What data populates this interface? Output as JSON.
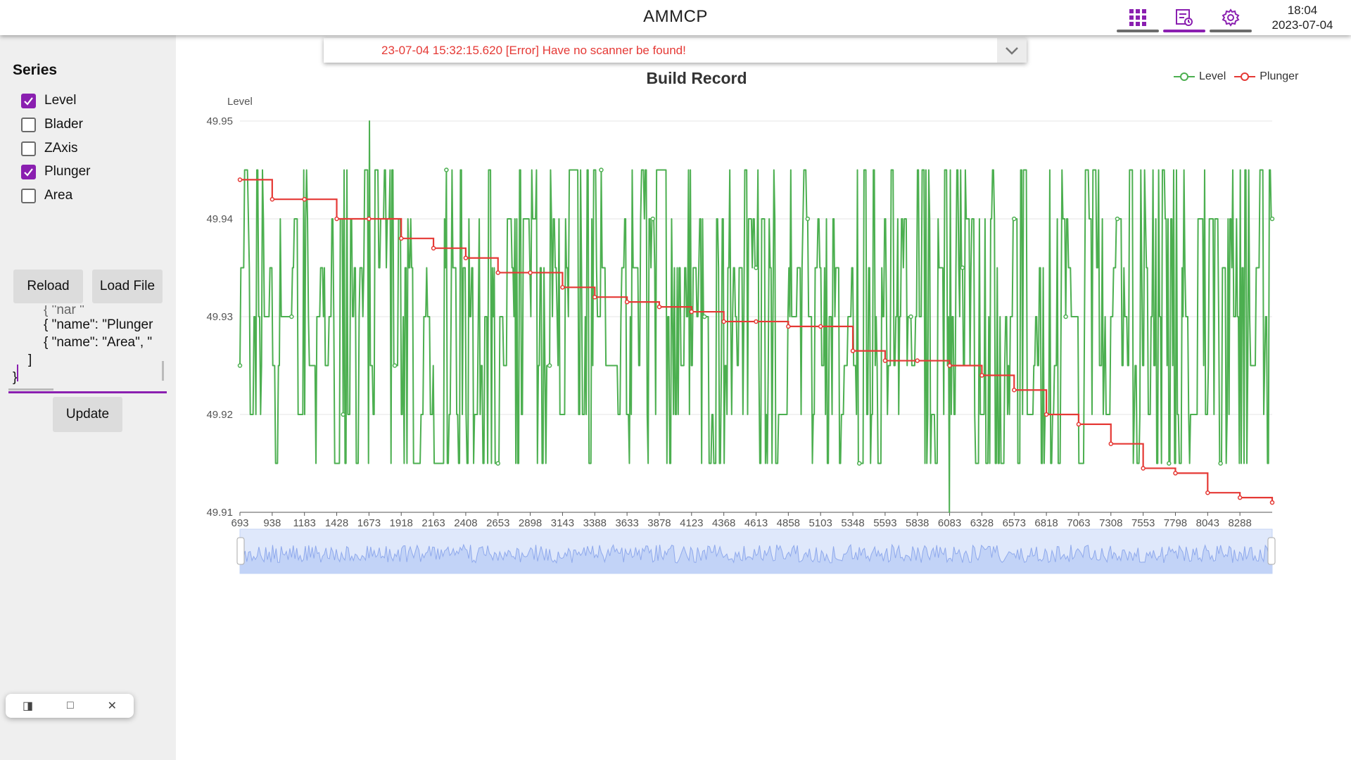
{
  "app": {
    "title": "AMMCP"
  },
  "clock": {
    "time": "18:04",
    "date": "2023-07-04"
  },
  "nav": [
    {
      "name": "grid-view",
      "icon": "grid-icon",
      "active": false
    },
    {
      "name": "records",
      "icon": "record-list-icon",
      "active": true
    },
    {
      "name": "settings",
      "icon": "gear-icon",
      "active": false
    }
  ],
  "error": {
    "message": "23-07-04 15:32:15.620 [Error] Have no scanner be found!"
  },
  "sidebar": {
    "heading": "Series",
    "series": [
      {
        "label": "Level",
        "checked": true
      },
      {
        "label": "Blader",
        "checked": false
      },
      {
        "label": "ZAxis",
        "checked": false
      },
      {
        "label": "Plunger",
        "checked": true
      },
      {
        "label": "Area",
        "checked": false
      }
    ],
    "reload_label": "Reload",
    "load_file_label": "Load File",
    "code_lines": [
      "{ \"name\": \"Plunger",
      "{ \"name\": \"Area\", \"",
      "]",
      "}"
    ],
    "update_label": "Update"
  },
  "window_controls": {
    "restore": "◨",
    "maximize": "□",
    "close": "✕"
  },
  "chart_data": {
    "type": "line",
    "title": "Build Record",
    "ylabel": "Level",
    "xlabel": "",
    "ylim": [
      49.91,
      49.95
    ],
    "yticks": [
      "49.95",
      "49.94",
      "49.93",
      "49.92",
      "49.91"
    ],
    "xticks": [
      "693",
      "938",
      "1183",
      "1428",
      "1673",
      "1918",
      "2163",
      "2408",
      "2653",
      "2898",
      "3143",
      "3388",
      "3633",
      "3878",
      "4123",
      "4368",
      "4613",
      "4858",
      "5103",
      "5348",
      "5593",
      "5838",
      "6083",
      "6328",
      "6573",
      "6818",
      "7063",
      "7308",
      "7553",
      "7798",
      "8043",
      "8288"
    ],
    "xlim": [
      693,
      8533
    ],
    "grid": true,
    "legend_position": "top-right",
    "series": [
      {
        "name": "Level",
        "color": "#4caf50",
        "levels": [
          49.915,
          49.92,
          49.925,
          49.93,
          49.935,
          49.94,
          49.945
        ],
        "x": [
          693,
          8288,
          8533
        ],
        "values": [
          49.925,
          49.915,
          49.94
        ]
      },
      {
        "name": "Plunger",
        "color": "#e53935",
        "x": [
          693,
          938,
          1183,
          1428,
          1673,
          1918,
          2163,
          2408,
          2653,
          2898,
          3143,
          3388,
          3633,
          3878,
          4123,
          4368,
          4613,
          4858,
          5103,
          5348,
          5593,
          5838,
          6083,
          6328,
          6573,
          6818,
          7063,
          7308,
          7553,
          7798,
          8043,
          8288,
          8533
        ],
        "values": [
          49.944,
          49.942,
          49.942,
          49.94,
          49.94,
          49.938,
          49.937,
          49.936,
          49.9345,
          49.9345,
          49.933,
          49.932,
          49.9315,
          49.931,
          49.9305,
          49.9295,
          49.9295,
          49.929,
          49.929,
          49.9265,
          49.9255,
          49.9255,
          49.925,
          49.924,
          49.9225,
          49.92,
          49.919,
          49.917,
          49.9145,
          49.914,
          49.912,
          49.9115,
          49.911
        ]
      }
    ],
    "navigator": {
      "range": [
        0,
        1
      ]
    }
  }
}
